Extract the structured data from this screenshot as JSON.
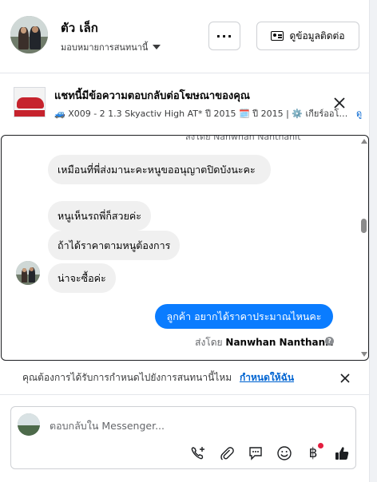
{
  "header": {
    "contact_name": "ตัว เล็ก",
    "assign_label": "มอบหมายการสนทนานี้",
    "more_label": "···",
    "view_contact_label": "ดูข้อมูลติดต่อ"
  },
  "ad_context": {
    "title": "แชทนี้มีข้อความตอบกลับต่อโฆษณาของคุณ",
    "subtitle": "🚙 X009 - 2 1.3 Skyactiv High AT* ปี 2015 🗓️ ปี 2015 | ⚙️ เกียร์ออโต...",
    "link": "ดู"
  },
  "messages": {
    "cut_top": "ส่งโดย Nanwhan Nanthanit",
    "incoming": [
      "เหมือนที่พี่ส่งมานะคะหนูขออนุญาตปิดบังนะคะ",
      "หนูเห็นรถพี่ก็สวยค่ะ",
      "ถ้าได้ราคาตามหนูต้องการ",
      "น่าจะซื้อค่ะ"
    ],
    "outgoing": "ลูกค้า อยากได้ราคาประมาณไหนคะ",
    "sent_by_prefix": "ส่งโดย",
    "sent_by_name": "Nanwhan Nanthanit",
    "help_glyph": "?"
  },
  "assign_banner": {
    "question": "คุณต้องการได้รับการกำหนดไปยังการสนทนานี้ไหม",
    "link": "กำหนดให้ฉัน"
  },
  "composer": {
    "placeholder": "ตอบกลับใน Messenger...",
    "tools": [
      "phone-add-icon",
      "paperclip-icon",
      "saved-reply-icon",
      "emoji-icon",
      "baht-icon",
      "like-icon"
    ],
    "baht_glyph": "฿"
  },
  "colors": {
    "accent": "#0a7cff",
    "link": "#0064d1",
    "notification": "#e41e3f"
  }
}
